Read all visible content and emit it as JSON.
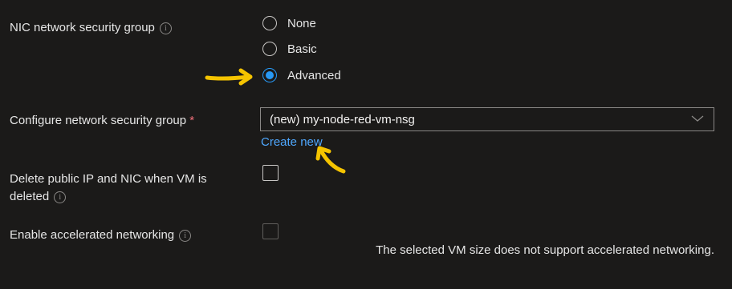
{
  "nsg": {
    "label": "NIC network security group",
    "options": [
      "None",
      "Basic",
      "Advanced"
    ],
    "selected": "Advanced"
  },
  "configure": {
    "label": "Configure network security group",
    "required_marker": "*",
    "value": "(new) my-node-red-vm-nsg",
    "create_new": "Create new"
  },
  "delete_ip": {
    "label_line1": "Delete public IP and NIC when VM is",
    "label_line2": "deleted",
    "checked": false
  },
  "accel": {
    "label": "Enable accelerated networking",
    "checked": false,
    "note": "The selected VM size does not support accelerated networking."
  },
  "icons": {
    "info": "info-icon",
    "dropdown": "chevron-down-icon",
    "annotation": "arrow-annotation-icon"
  },
  "colors": {
    "background": "#1b1a19",
    "accent": "#2899f5",
    "link": "#4fa8ff",
    "annotation": "#f5c400",
    "required": "#f1707b"
  }
}
